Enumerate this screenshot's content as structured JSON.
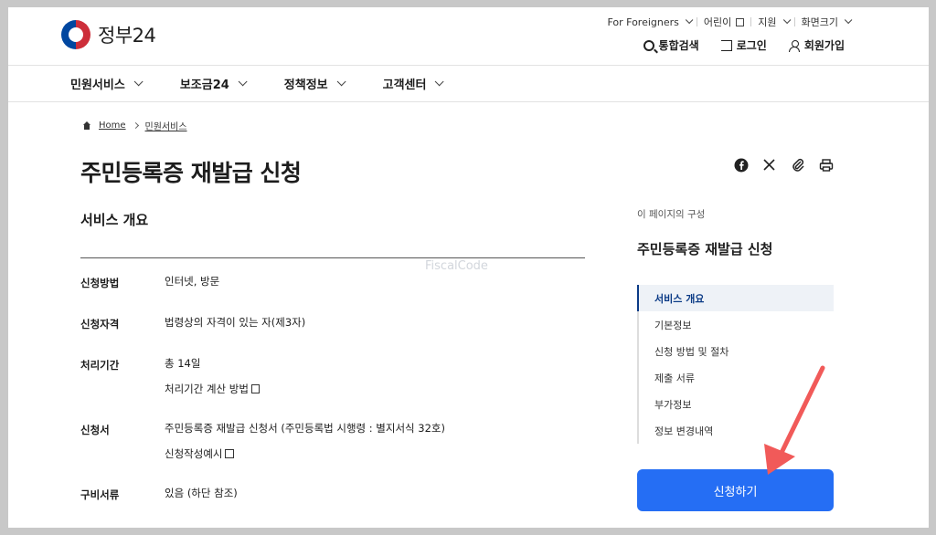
{
  "header": {
    "logo_text": "정부24",
    "utility": [
      "For Foreigners",
      "어린이",
      "지원",
      "화면크기"
    ],
    "actions": {
      "search": "통합검색",
      "login": "로그인",
      "signup": "회원가입"
    }
  },
  "gnb": [
    "민원서비스",
    "보조금24",
    "정책정보",
    "고객센터"
  ],
  "breadcrumb": {
    "home": "Home",
    "current": "민원서비스"
  },
  "page_title": "주민등록증 재발급 신청",
  "section_title": "서비스 개요",
  "watermark": "FiscalCode",
  "info_rows": [
    {
      "label": "신청방법",
      "values": [
        "인터넷, 방문"
      ]
    },
    {
      "label": "신청자격",
      "values": [
        "법령상의 자격이 있는 자(제3자)"
      ]
    },
    {
      "label": "처리기간",
      "values": [
        "총 14일",
        "처리기간 계산 방법"
      ]
    },
    {
      "label": "신청서",
      "values": [
        "주민등록증 재발급 신청서 (주민등록법 시행령 : 별지서식 32호)",
        "신청작성예시"
      ]
    },
    {
      "label": "구비서류",
      "values": [
        "있음 (하단 참조)"
      ]
    }
  ],
  "toc": {
    "label": "이 페이지의 구성",
    "title": "주민등록증 재발급 신청",
    "items": [
      "서비스 개요",
      "기본정보",
      "신청 방법 및 절차",
      "제출 서류",
      "부가정보",
      "정보 변경내역"
    ]
  },
  "apply_button": "신청하기",
  "colors": {
    "accent": "#256ef4",
    "annotation_arrow": "#f15a59"
  }
}
